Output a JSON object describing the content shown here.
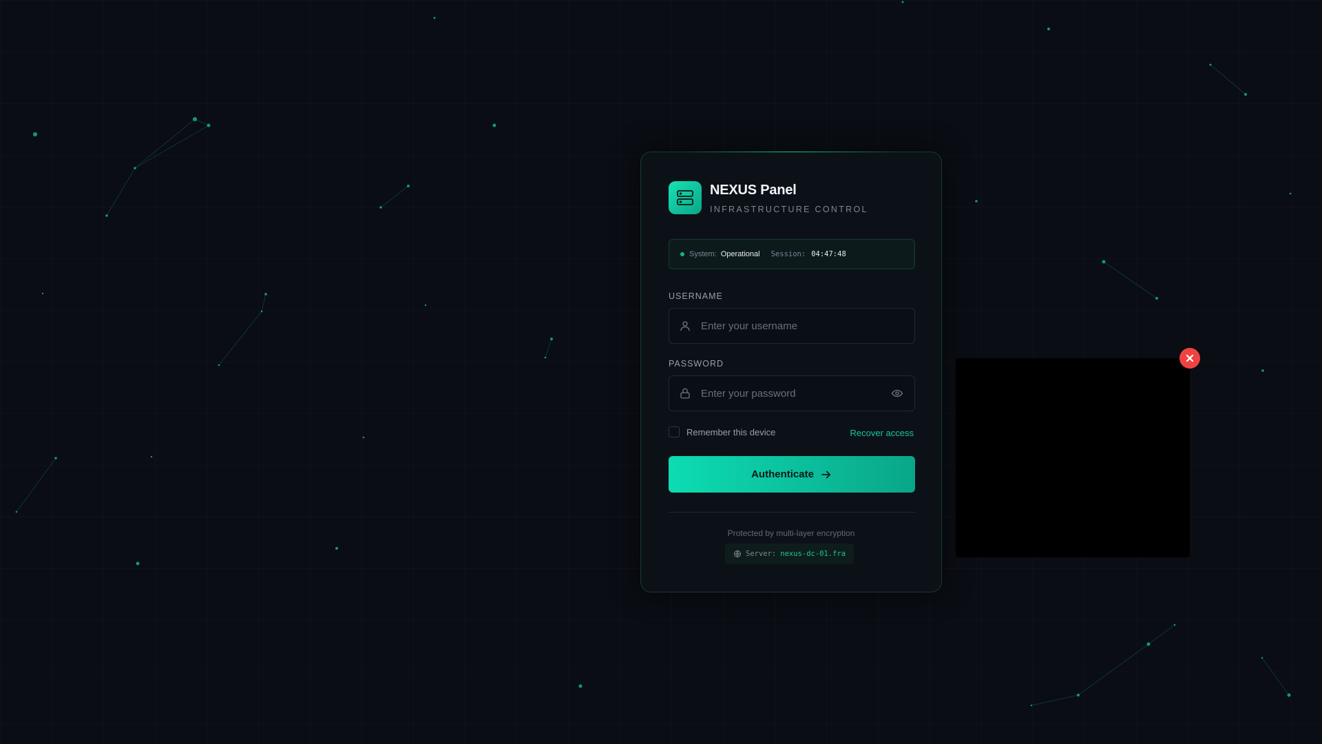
{
  "app": {
    "title": "NEXUS Panel",
    "subtitle": "INFRASTRUCTURE CONTROL",
    "logo_icon": "server-stack-icon",
    "accent_color": "#10c9a0"
  },
  "status": {
    "system_label": "System:",
    "system_value": "Operational",
    "session_label": "Session:",
    "session_value": "04:47:48"
  },
  "form": {
    "username": {
      "label": "USERNAME",
      "placeholder": "Enter your username",
      "value": "",
      "icon": "user-icon"
    },
    "password": {
      "label": "PASSWORD",
      "placeholder": "Enter your password",
      "value": "",
      "icon": "lock-icon",
      "toggle_icon": "eye-icon"
    },
    "remember_label": "Remember this device",
    "remember_checked": false,
    "recover_link": "Recover access",
    "submit_label": "Authenticate"
  },
  "footer": {
    "note": "Protected by multi-layer encryption",
    "server_label": "Server:",
    "server_value": "nexus-dc-01.fra",
    "server_icon": "globe-icon"
  },
  "overlay": {
    "close_icon": "close-icon",
    "close_color": "#ef4343"
  }
}
